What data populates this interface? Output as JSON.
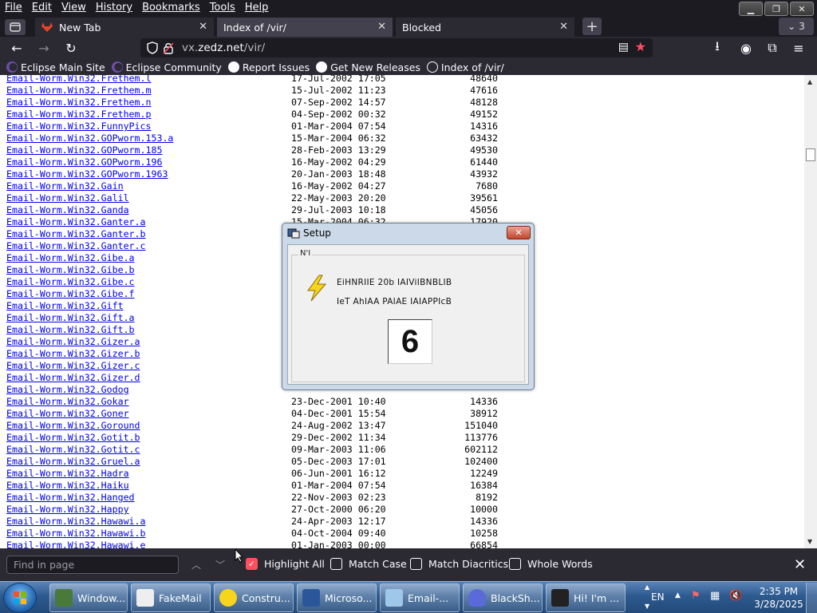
{
  "menubar": {
    "items": [
      "File",
      "Edit",
      "View",
      "History",
      "Bookmarks",
      "Tools",
      "Help"
    ]
  },
  "tabs": [
    {
      "label": "New Tab"
    },
    {
      "label": "Index of /vir/"
    },
    {
      "label": "Blocked"
    }
  ],
  "tab_count": "3",
  "urlbar": {
    "host_dim": "vx.",
    "host": "zedz.net",
    "path": "/vir/"
  },
  "bookmarks": [
    "Eclipse Main Site",
    "Eclipse Community",
    "Report Issues",
    "Get New Releases",
    "Index of /vir/"
  ],
  "listing": [
    {
      "name": "Email-Worm.Win32.Frethem.l",
      "date": "17-Jul-2002 17:05",
      "size": "48640"
    },
    {
      "name": "Email-Worm.Win32.Frethem.m",
      "date": "15-Jul-2002 11:23",
      "size": "47616"
    },
    {
      "name": "Email-Worm.Win32.Frethem.n",
      "date": "07-Sep-2002 14:57",
      "size": "48128"
    },
    {
      "name": "Email-Worm.Win32.Frethem.p",
      "date": "04-Sep-2002 00:32",
      "size": "49152"
    },
    {
      "name": "Email-Worm.Win32.FunnyPics",
      "date": "01-Mar-2004 07:54",
      "size": "14316"
    },
    {
      "name": "Email-Worm.Win32.GOPworm.153.a",
      "date": "15-Mar-2004 06:32",
      "size": "63432"
    },
    {
      "name": "Email-Worm.Win32.GOPworm.185",
      "date": "28-Feb-2003 13:29",
      "size": "49530"
    },
    {
      "name": "Email-Worm.Win32.GOPworm.196",
      "date": "16-May-2002 04:29",
      "size": "61440"
    },
    {
      "name": "Email-Worm.Win32.GOPworm.1963",
      "date": "20-Jan-2003 18:48",
      "size": "43932"
    },
    {
      "name": "Email-Worm.Win32.Gain",
      "date": "16-May-2002 04:27",
      "size": "7680"
    },
    {
      "name": "Email-Worm.Win32.Galil",
      "date": "22-May-2003 20:20",
      "size": "39561"
    },
    {
      "name": "Email-Worm.Win32.Ganda",
      "date": "29-Jul-2003 10:18",
      "size": "45056"
    },
    {
      "name": "Email-Worm.Win32.Ganter.a",
      "date": "15-Mar-2004 06:32",
      "size": "17920"
    },
    {
      "name": "Email-Worm.Win32.Ganter.b",
      "date": "",
      "size": ""
    },
    {
      "name": "Email-Worm.Win32.Ganter.c",
      "date": "",
      "size": ""
    },
    {
      "name": "Email-Worm.Win32.Gibe.a",
      "date": "",
      "size": ""
    },
    {
      "name": "Email-Worm.Win32.Gibe.b",
      "date": "",
      "size": ""
    },
    {
      "name": "Email-Worm.Win32.Gibe.c",
      "date": "",
      "size": ""
    },
    {
      "name": "Email-Worm.Win32.Gibe.f",
      "date": "",
      "size": ""
    },
    {
      "name": "Email-Worm.Win32.Gift",
      "date": "",
      "size": ""
    },
    {
      "name": "Email-Worm.Win32.Gift.a",
      "date": "",
      "size": ""
    },
    {
      "name": "Email-Worm.Win32.Gift.b",
      "date": "",
      "size": ""
    },
    {
      "name": "Email-Worm.Win32.Gizer.a",
      "date": "",
      "size": ""
    },
    {
      "name": "Email-Worm.Win32.Gizer.b",
      "date": "",
      "size": ""
    },
    {
      "name": "Email-Worm.Win32.Gizer.c",
      "date": "",
      "size": ""
    },
    {
      "name": "Email-Worm.Win32.Gizer.d",
      "date": "",
      "size": ""
    },
    {
      "name": "Email-Worm.Win32.Godog",
      "date": "",
      "size": ""
    },
    {
      "name": "Email-Worm.Win32.Gokar",
      "date": "23-Dec-2001 10:40",
      "size": "14336"
    },
    {
      "name": "Email-Worm.Win32.Goner",
      "date": "04-Dec-2001 15:54",
      "size": "38912"
    },
    {
      "name": "Email-Worm.Win32.Goround",
      "date": "24-Aug-2002 13:47",
      "size": "151040"
    },
    {
      "name": "Email-Worm.Win32.Gotit.b",
      "date": "29-Dec-2002 11:34",
      "size": "113776"
    },
    {
      "name": "Email-Worm.Win32.Gotit.c",
      "date": "09-Mar-2003 11:06",
      "size": "602112"
    },
    {
      "name": "Email-Worm.Win32.Gruel.a",
      "date": "05-Dec-2003 17:01",
      "size": "102400"
    },
    {
      "name": "Email-Worm.Win32.Hadra",
      "date": "06-Jun-2001 16:12",
      "size": "12249"
    },
    {
      "name": "Email-Worm.Win32.Haiku",
      "date": "01-Mar-2004 07:54",
      "size": "16384"
    },
    {
      "name": "Email-Worm.Win32.Hanged",
      "date": "22-Nov-2003 02:23",
      "size": "8192"
    },
    {
      "name": "Email-Worm.Win32.Happy",
      "date": "27-Oct-2000 06:20",
      "size": "10000"
    },
    {
      "name": "Email-Worm.Win32.Hawawi.a",
      "date": "24-Apr-2003 12:17",
      "size": "14336"
    },
    {
      "name": "Email-Worm.Win32.Hawawi.b",
      "date": "04-Oct-2004 09:40",
      "size": "10258"
    },
    {
      "name": "Email-Worm.Win32.Hawawi.e",
      "date": "01-Jan-2003 00:00",
      "size": "66854"
    }
  ],
  "dialog": {
    "title": "Setup",
    "group_label": "N'I",
    "line1": "EiHNRIIE 20b IAIViIBNBLIB",
    "line2": "IeT AhIAA PAIAE IAIAPPIcB",
    "counter": "6"
  },
  "findbar": {
    "placeholder": "Find in page",
    "options": [
      {
        "label": "Highlight All",
        "checked": true
      },
      {
        "label": "Match Case",
        "checked": false
      },
      {
        "label": "Match Diacritics",
        "checked": false
      },
      {
        "label": "Whole Words",
        "checked": false
      }
    ]
  },
  "taskbar": {
    "items": [
      "Window...",
      "FakeMail",
      "Constru...",
      "Microso...",
      "Email-...",
      "BlackSh...",
      "Hi! I'm ..."
    ],
    "lang": "EN",
    "time": "2:35 PM",
    "date": "3/28/2025"
  },
  "colors": {
    "chrome_dark": "#1c1b22",
    "chrome": "#2b2a33",
    "link": "#0000ee",
    "accent": "#ff4f5e"
  }
}
